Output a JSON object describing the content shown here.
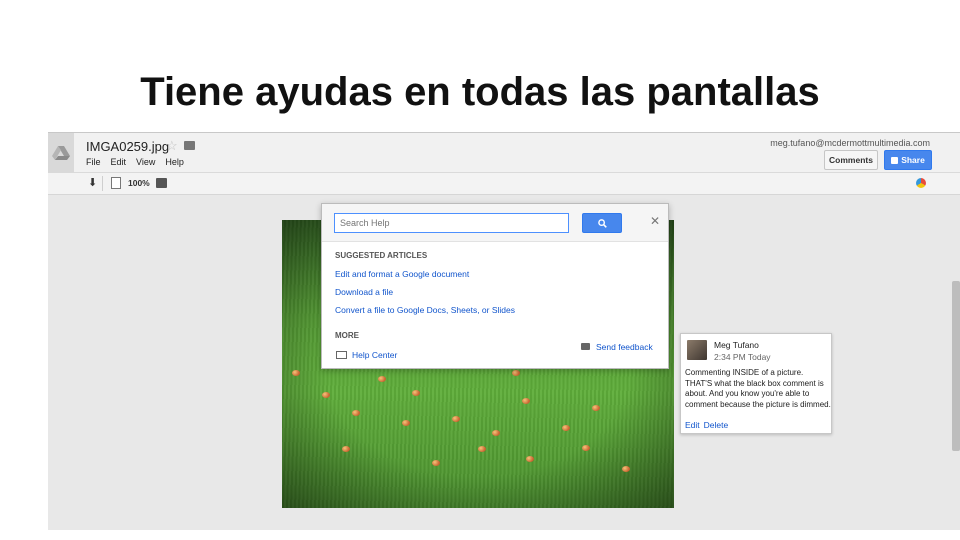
{
  "slide": {
    "title": "Tiene ayudas en todas las pantallas"
  },
  "app": {
    "file_name": "IMGA0259.jpg",
    "menu": [
      "File",
      "Edit",
      "View",
      "Help"
    ],
    "account": "meg.tufano@mcdermottmultimedia.com",
    "comments_label": "Comments",
    "share_label": "Share"
  },
  "toolbar": {
    "zoom": "100%"
  },
  "help": {
    "search_placeholder": "Search Help",
    "suggested_heading": "SUGGESTED ARTICLES",
    "articles": [
      "Edit and format a Google document",
      "Download a file",
      "Convert a file to Google Docs, Sheets, or Slides"
    ],
    "more_heading": "MORE",
    "help_center": "Help Center",
    "send_feedback": "Send feedback"
  },
  "comment": {
    "author": "Meg Tufano",
    "time": "2:34 PM Today",
    "body": "Commenting INSIDE of a picture. THAT'S what the black box comment is about. And you know you're able to comment because the picture is dimmed.",
    "edit": "Edit",
    "delete": "Delete"
  },
  "colors": {
    "accent": "#4787ed",
    "link": "#1155cc"
  },
  "icons": [
    "drive-logo-icon",
    "star-icon",
    "folder-icon",
    "download-icon",
    "fit-icon",
    "caption-icon",
    "apps-icon",
    "search-icon",
    "close-icon",
    "help-center-icon",
    "feedback-icon",
    "share-person-icon"
  ]
}
